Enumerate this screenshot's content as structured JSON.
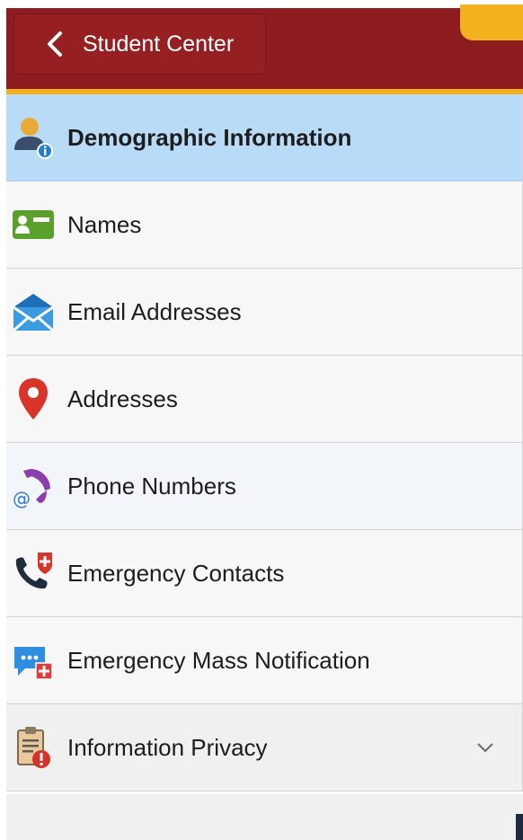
{
  "header": {
    "back_label": "Student Center"
  },
  "nav": {
    "items": [
      {
        "label": "Demographic Information",
        "icon": "user-info-icon",
        "active": true
      },
      {
        "label": "Names",
        "icon": "name-card-icon"
      },
      {
        "label": "Email Addresses",
        "icon": "envelope-icon"
      },
      {
        "label": "Addresses",
        "icon": "map-pin-icon"
      },
      {
        "label": "Phone Numbers",
        "icon": "phone-at-icon"
      },
      {
        "label": "Emergency Contacts",
        "icon": "emergency-phone-icon"
      },
      {
        "label": "Emergency Mass Notification",
        "icon": "notification-chat-icon"
      },
      {
        "label": "Information Privacy",
        "icon": "privacy-clipboard-icon",
        "expandable": true
      }
    ]
  },
  "colors": {
    "header_bg": "#8e1b1e",
    "accent": "#f2b01c",
    "active_bg": "#b8dcf7"
  }
}
